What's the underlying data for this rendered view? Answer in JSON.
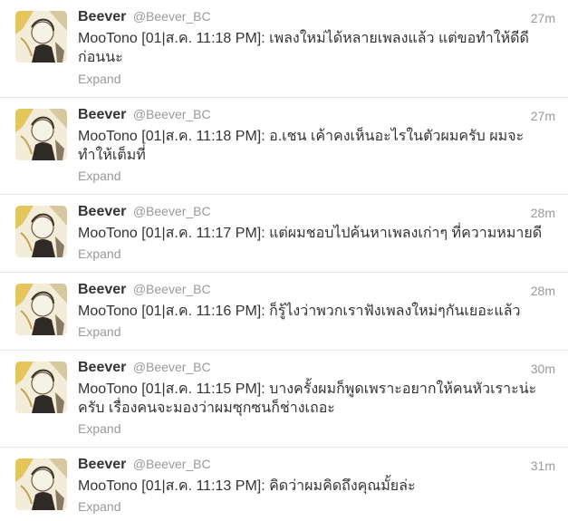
{
  "tweets": [
    {
      "fullname": "Beever",
      "username": "@Beever_BC",
      "time": "27m",
      "text": "MooTono [01|ส.ค. 11:18 PM]: เพลงใหม่ได้หลายเพลงแล้ว แต่ขอทำให้ดีดีก่อนนะ",
      "expand": "Expand"
    },
    {
      "fullname": "Beever",
      "username": "@Beever_BC",
      "time": "27m",
      "text": "MooTono [01|ส.ค. 11:18 PM]: อ.เชน เค้าคงเห็นอะไรในตัวผมครับ ผมจะทำให้เต็มที่",
      "expand": "Expand"
    },
    {
      "fullname": "Beever",
      "username": "@Beever_BC",
      "time": "28m",
      "text": "MooTono [01|ส.ค. 11:17 PM]: แต่ผมชอบไปค้นหาเพลงเก่าๆ ที่ความหมายดี",
      "expand": "Expand"
    },
    {
      "fullname": "Beever",
      "username": "@Beever_BC",
      "time": "28m",
      "text": "MooTono [01|ส.ค. 11:16 PM]: ก็รู้ไงว่าพวกเราฟังเพลงใหม่ๆกันเยอะแล้ว",
      "expand": "Expand"
    },
    {
      "fullname": "Beever",
      "username": "@Beever_BC",
      "time": "30m",
      "text": "MooTono [01|ส.ค. 11:15 PM]: บางครั้งผมก็พูดเพราะอยากให้คนหัวเราะน่ะครับ เรื่องคนจะมองว่าผมซุกซนก็ช่างเถอะ",
      "expand": "Expand"
    },
    {
      "fullname": "Beever",
      "username": "@Beever_BC",
      "time": "31m",
      "text": "MooTono [01|ส.ค. 11:13 PM]: คิดว่าผมคิดถึงคุณมั้ยล่ะ",
      "expand": "Expand"
    }
  ],
  "colors": {
    "text": "#333333",
    "meta": "#999999",
    "divider": "#e8e8e8"
  },
  "icons": {
    "avatar": "avatar-image"
  }
}
